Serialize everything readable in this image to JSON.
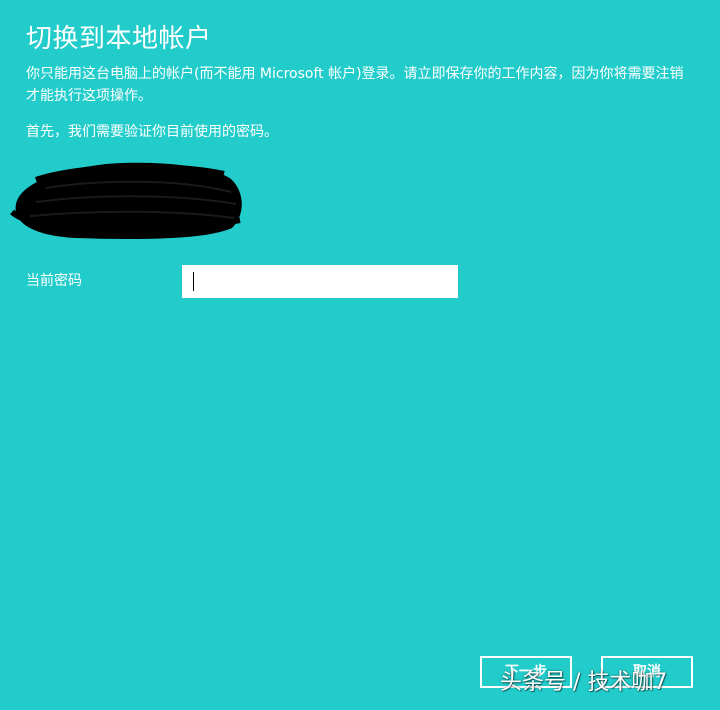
{
  "page": {
    "title": "切换到本地帐户",
    "description": "你只能用这台电脑上的帐户(而不能用 Microsoft 帐户)登录。请立即保存你的工作内容，因为你将需要注销才能执行这项操作。",
    "verify_text": "首先，我们需要验证你目前使用的密码。",
    "password_label": "当前密码",
    "password_value": ""
  },
  "buttons": {
    "next_label": "下一步",
    "cancel_label": "取消"
  },
  "watermark": {
    "text": "头条号 / 技术咖7"
  },
  "colors": {
    "background": "#22cccb",
    "text": "#ffffff",
    "input_bg": "#ffffff",
    "redaction": "#000000"
  }
}
